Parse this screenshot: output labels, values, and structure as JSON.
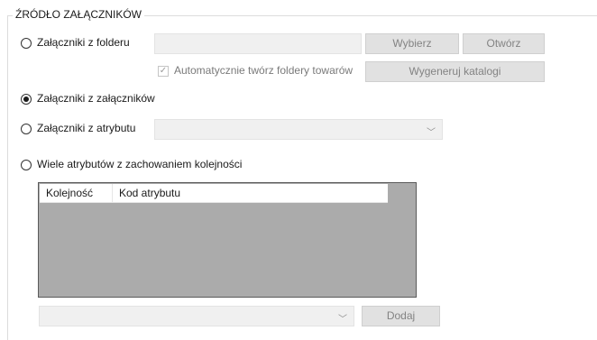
{
  "group": {
    "title": "ŹRÓDŁO ZAŁĄCZNIKÓW"
  },
  "options": {
    "from_folder": {
      "label": "Załączniki z folderu",
      "checked": false
    },
    "from_attachments": {
      "label": "Załączniki z załączników",
      "checked": true
    },
    "from_attribute": {
      "label": "Załączniki z atrybutu",
      "checked": false
    },
    "multi_attributes": {
      "label": "Wiele atrybutów z zachowaniem kolejności",
      "checked": false
    }
  },
  "folder": {
    "path_value": "",
    "choose_label": "Wybierz",
    "open_label": "Otwórz",
    "auto_create_label": "Automatycznie twórz foldery towarów",
    "auto_create_checked": true,
    "generate_label": "Wygeneruj katalogi"
  },
  "attribute": {
    "selected": ""
  },
  "grid": {
    "columns": [
      "Kolejność",
      "Kod atrybutu"
    ],
    "rows": []
  },
  "add": {
    "selected": "",
    "button_label": "Dodaj"
  },
  "icons": {
    "check": "check-icon",
    "dropdown": "chevron-down-icon"
  }
}
